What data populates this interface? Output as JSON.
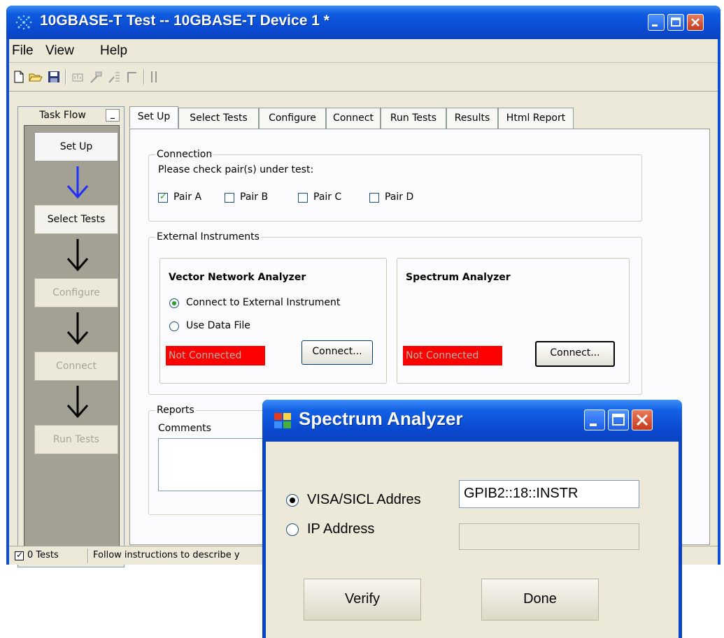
{
  "window": {
    "title": "10GBASE-T Test -- 10GBASE-T Device 1 *",
    "caption_buttons": [
      "minimize-icon",
      "maximize-icon",
      "close-icon"
    ]
  },
  "menu": {
    "items": [
      "File",
      "View",
      "Help"
    ]
  },
  "toolbar": {
    "icons": [
      "new-icon",
      "open-icon",
      "save-icon",
      "report-icon",
      "run-icon",
      "run-all-icon",
      "stop-icon",
      "pause-icon"
    ]
  },
  "taskflow": {
    "header": "Task Flow",
    "min_label": "_",
    "steps": [
      {
        "label": "Set Up",
        "state": "active"
      },
      {
        "label": "Select Tests",
        "state": "enabled"
      },
      {
        "label": "Configure",
        "state": "disabled"
      },
      {
        "label": "Connect",
        "state": "disabled"
      },
      {
        "label": "Run Tests",
        "state": "disabled"
      }
    ]
  },
  "tabs": [
    "Set Up",
    "Select Tests",
    "Configure",
    "Connect",
    "Run Tests",
    "Results",
    "Html Report"
  ],
  "active_tab": "Set Up",
  "connection": {
    "legend": "Connection",
    "prompt": "Please check pair(s) under test:",
    "pairs": [
      {
        "label": "Pair A",
        "checked": true
      },
      {
        "label": "Pair B",
        "checked": false
      },
      {
        "label": "Pair C",
        "checked": false
      },
      {
        "label": "Pair D",
        "checked": false
      }
    ]
  },
  "instruments": {
    "legend": "External Instruments",
    "vna": {
      "title": "Vector Network Analyzer",
      "options": [
        "Connect to External Instrument",
        "Use Data File"
      ],
      "selected": 0,
      "status": "Not Connected",
      "button": "Connect..."
    },
    "spectrum": {
      "title": "Spectrum Analyzer",
      "status": "Not Connected",
      "button": "Connect..."
    }
  },
  "reports": {
    "legend": "Reports",
    "comments_label": "Comments"
  },
  "statusbar": {
    "tests": "0 Tests",
    "tests_checked": true,
    "message": "Follow instructions to describe y"
  },
  "dialog": {
    "title": "Spectrum Analyzer",
    "visa_label": "VISA/SICL Addres",
    "visa_value": "GPIB2::18::INSTR",
    "ip_label": "IP Address",
    "ip_value": "",
    "selected": "visa",
    "verify_label": "Verify",
    "done_label": "Done"
  },
  "colors": {
    "titlebar": "#0a4ad0",
    "status_not_connected": "#ff0000",
    "window_bg": "#ece9d8"
  }
}
